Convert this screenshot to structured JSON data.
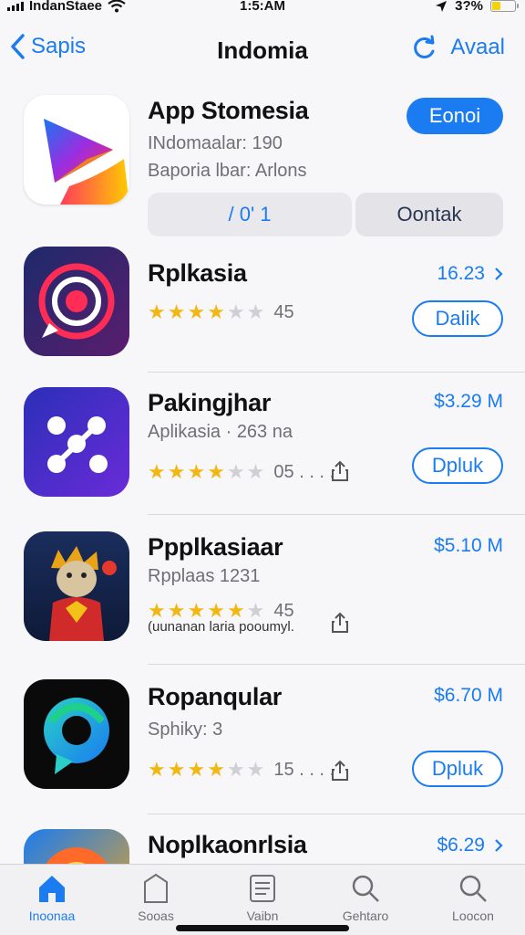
{
  "status_bar": {
    "carrier": "IndanStaee",
    "time": "1:5:AM",
    "battery": "3?%",
    "battery_level": 0.37
  },
  "nav": {
    "back_label": "Sapis",
    "title": "Indomia",
    "right_label": "Avaal"
  },
  "featured": {
    "name": "App Stomesia",
    "line1": "INdomaalar: 190",
    "line2": "Baporia lbar: Arlons",
    "get_label": "Eonoi",
    "segment_left": "/ 0' 1",
    "segment_right": "Oontak"
  },
  "apps": [
    {
      "name": "Rplkasia",
      "price": "16.23",
      "rating": 3.5,
      "count": "45",
      "button": "Dalik"
    },
    {
      "name": "Pakingjhar",
      "sub": "Aplikasia · 263 na",
      "price": "$3.29 M",
      "rating": 3.5,
      "count": "05 . . . .",
      "button": "Dpluk"
    },
    {
      "name": "Ppplkasiaar",
      "sub": "Rpplaas 1231",
      "caption": "(uunanan laria pooumyl.",
      "price": "$5.10 M",
      "rating": 4.5,
      "count": "45"
    },
    {
      "name": "Ropanqular",
      "sub": "Sphiky: 3",
      "price": "$6.70 M",
      "rating": 3.5,
      "count": "15 . . . .",
      "button": "Dpluk"
    },
    {
      "name": "Noplkaonrlsia",
      "price": "$6.29"
    }
  ],
  "tabs": [
    {
      "label": "Inoonaa",
      "icon": "home-icon",
      "active": true
    },
    {
      "label": "Sooas",
      "icon": "tag-icon"
    },
    {
      "label": "Vaibn",
      "icon": "list-icon"
    },
    {
      "label": "Gehtaro",
      "icon": "search-icon"
    },
    {
      "label": "Loocon",
      "icon": "search-icon"
    }
  ],
  "colors": {
    "accent": "#1a7cf0",
    "star": "#f3b714",
    "battery": "#f5d20a"
  }
}
